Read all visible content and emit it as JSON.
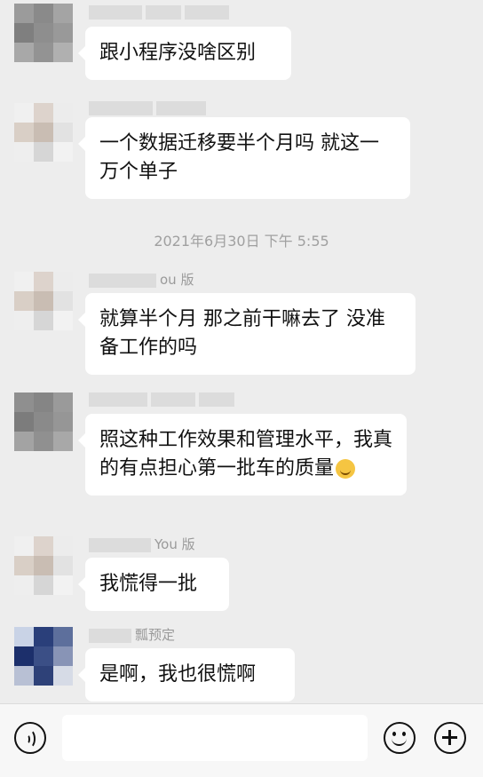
{
  "timestamp": "2021年6月30日 下午 5:55",
  "messages": [
    {
      "name": "",
      "text": "跟小程序没啥区别"
    },
    {
      "name": "",
      "text": "一个数据迁移要半个月吗 就这一万个单子"
    },
    {
      "name": "ou 版",
      "text": "就算半个月 那之前干嘛去了 没准备工作的吗"
    },
    {
      "name": "",
      "text": "照这种工作效果和管理水平，我真的有点担心第一批车的质量"
    },
    {
      "name": "You 版",
      "text": "我慌得一批"
    },
    {
      "name": "瓢预定",
      "text": "是啊，我也很慌啊"
    }
  ],
  "icons": {
    "voice": "voice-icon",
    "emoji": "emoji-icon",
    "plus": "plus-icon",
    "inline_emoji": "grimace-emoji"
  },
  "colors": {
    "background": "#ededed",
    "bubble": "#ffffff",
    "input_bar": "#f7f7f7"
  }
}
